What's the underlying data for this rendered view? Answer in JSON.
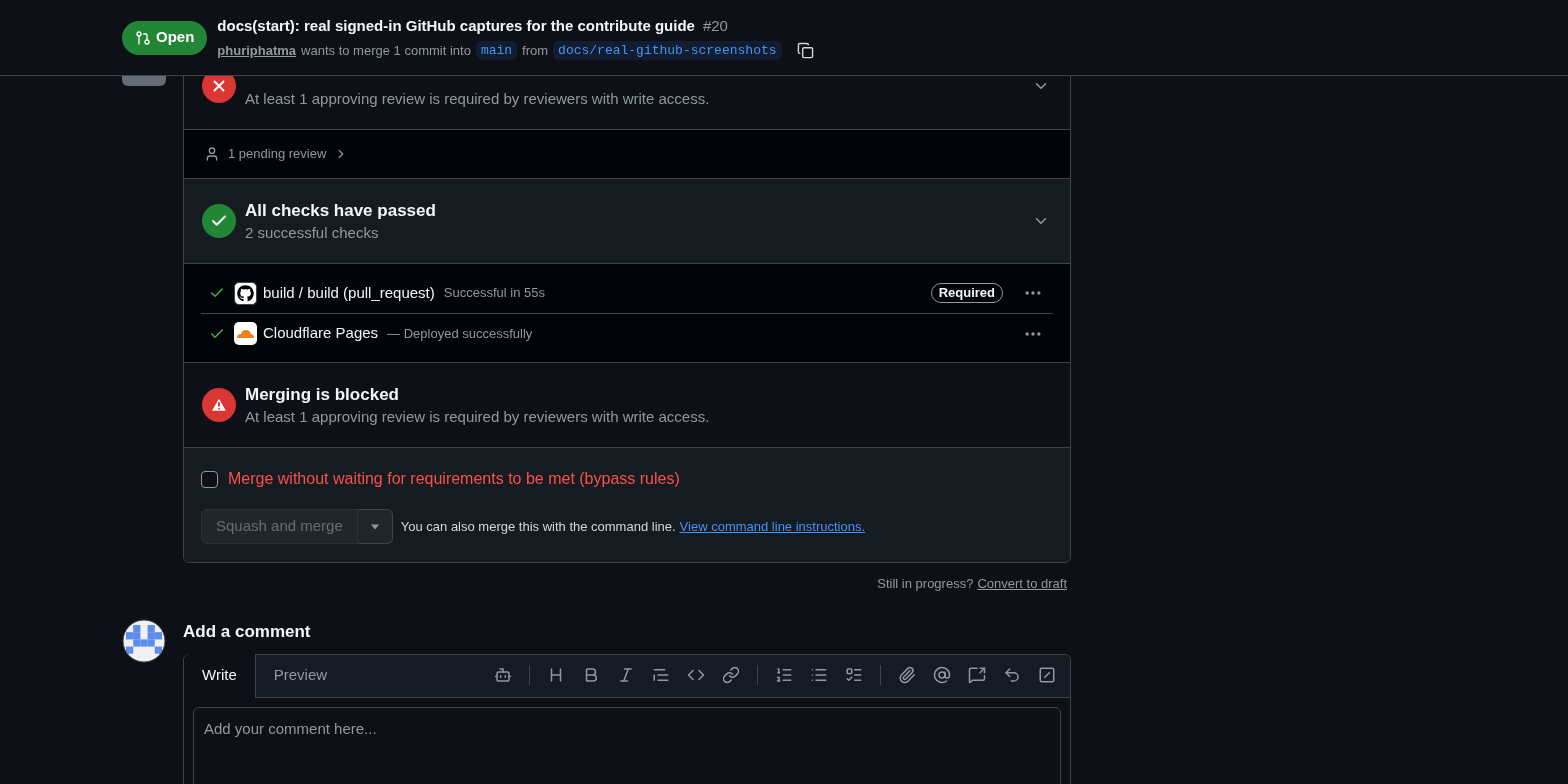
{
  "header": {
    "status": {
      "label": "Open",
      "kind": "open"
    },
    "title": "docs(start): real signed-in GitHub captures for the contribute guide",
    "number": "#20",
    "author": "phuriphatma",
    "merge_text": "wants to merge 1 commit into",
    "base_branch": "main",
    "from_text": "from",
    "head_branch": "docs/real-github-screenshots"
  },
  "review": {
    "kind": "failure",
    "description": "At least 1 approving review is required by reviewers with write access.",
    "expanded": false
  },
  "pending": {
    "label": "1 pending review"
  },
  "checks_summary": {
    "kind": "success",
    "title": "All checks have passed",
    "description": "2 successful checks",
    "expanded": false
  },
  "checks": [
    {
      "kind": "github",
      "name": "build / build (pull_request)",
      "detail": "Successful in 55s",
      "badge": "Required"
    },
    {
      "kind": "cloudflare",
      "name": "Cloudflare Pages",
      "detail": "— Deployed successfully"
    }
  ],
  "blocked": {
    "kind": "warning",
    "title": "Merging is blocked",
    "description": "At least 1 approving review is required by reviewers with write access."
  },
  "bypass": {
    "label": "Merge without waiting for requirements to be met (bypass rules)",
    "checked": false
  },
  "merge_button": {
    "label": "Squash and merge",
    "disabled": true
  },
  "command_line": {
    "text": "You can also merge this with the command line.",
    "link": "View command line instructions."
  },
  "draft": {
    "text": "Still in progress?",
    "link": "Convert to draft"
  },
  "comment": {
    "heading": "Add a comment",
    "tabs": [
      {
        "label": "Write",
        "selected": true
      },
      {
        "label": "Preview",
        "selected": false
      }
    ],
    "placeholder": "Add your comment here..."
  }
}
